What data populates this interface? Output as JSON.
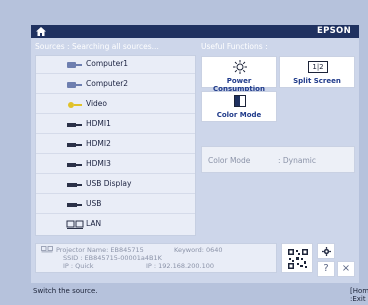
{
  "header": {
    "brand": "EPSON"
  },
  "sources": {
    "title": "Sources : Searching all sources...",
    "items": [
      {
        "label": "Computer1",
        "icon": "computer-port-icon"
      },
      {
        "label": "Computer2",
        "icon": "computer-port-icon"
      },
      {
        "label": "Video",
        "icon": "video-port-icon"
      },
      {
        "label": "HDMI1",
        "icon": "hdmi-port-icon"
      },
      {
        "label": "HDMI2",
        "icon": "hdmi-port-icon"
      },
      {
        "label": "HDMI3",
        "icon": "hdmi-port-icon"
      },
      {
        "label": "USB Display",
        "icon": "usb-display-icon"
      },
      {
        "label": "USB",
        "icon": "usb-icon"
      },
      {
        "label": "LAN",
        "icon": "lan-icon"
      }
    ]
  },
  "functions": {
    "title": "Useful Functions :",
    "power_consumption": "Power Consumption",
    "split_screen": "Split Screen",
    "color_mode": "Color Mode",
    "split_icon_text": "1|2"
  },
  "mode_panel": {
    "key": "Color Mode",
    "value": ": Dynamic"
  },
  "info": {
    "projector_name": "Projector Name: EB845715",
    "keyword": "Keyword: 0640",
    "ssid": "SSID : EB845715-00001a4B1K",
    "ip_quick": "IP : Quick",
    "ip_address": "IP : 192.168.200.100"
  },
  "footer": {
    "hint": "Switch the source.",
    "exit": "[Home] :Exit"
  },
  "colors": {
    "title_bar": "#1f3160",
    "background": "#cdd6ea",
    "accent": "#1f3a8a"
  }
}
